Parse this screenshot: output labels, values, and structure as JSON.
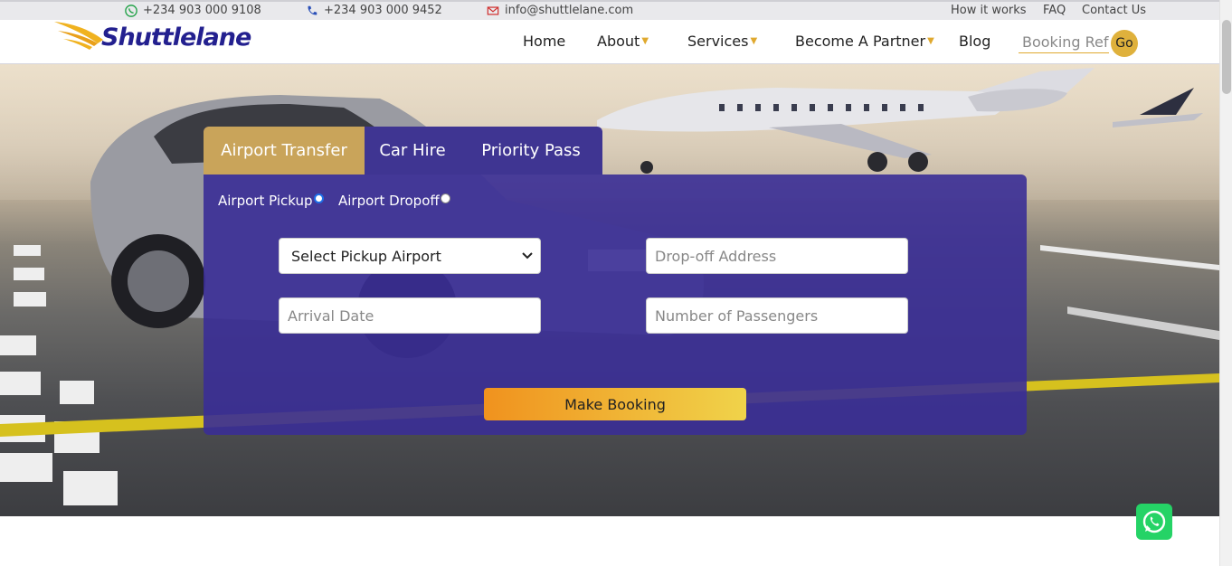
{
  "topbar": {
    "whatsapp_phone": "+234 903 000 9108",
    "phone": "+234 903 000 9452",
    "email": "info@shuttlelane.com",
    "links": [
      "How it works",
      "FAQ",
      "Contact Us"
    ]
  },
  "navbar": {
    "brand": "Shuttlelane",
    "items": [
      {
        "label": "Home",
        "dropdown": false
      },
      {
        "label": "About",
        "dropdown": true
      },
      {
        "label": "Services",
        "dropdown": true
      },
      {
        "label": "Become A Partner",
        "dropdown": true
      },
      {
        "label": "Blog",
        "dropdown": false
      }
    ],
    "booking_ref_placeholder": "Booking Ref",
    "go_label": "Go"
  },
  "booking": {
    "tabs": [
      "Airport Transfer",
      "Car Hire",
      "Priority Pass"
    ],
    "active_tab": "Airport Transfer",
    "options": [
      {
        "label": "Airport Pickup",
        "checked": true
      },
      {
        "label": "Airport Dropoff",
        "checked": false
      }
    ],
    "pickup_airport": "Select Pickup Airport",
    "dropoff_placeholder": "Drop-off Address",
    "arrival_placeholder": "Arrival Date",
    "passengers_placeholder": "Number of Passengers",
    "submit_label": "Make Booking"
  },
  "colors": {
    "brand_blue": "#23208f",
    "accent_gold": "#c9a45a",
    "card_purple": "#3a2e96",
    "whatsapp_green": "#25d366"
  }
}
